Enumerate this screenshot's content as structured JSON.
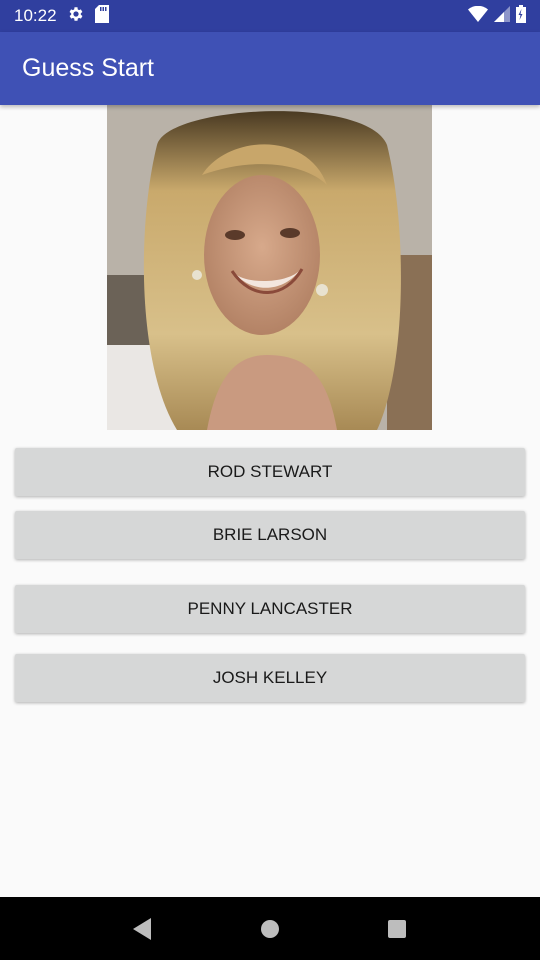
{
  "status_bar": {
    "time": "10:22",
    "icons_left": [
      "gear-icon",
      "sd-card-icon"
    ],
    "icons_right": [
      "wifi-icon",
      "signal-icon",
      "battery-icon"
    ]
  },
  "app_bar": {
    "title": "Guess Start",
    "color": "#3f51b5"
  },
  "photo": {
    "description_icon": "celebrity-photo"
  },
  "answers": [
    {
      "label": "ROD STEWART"
    },
    {
      "label": "BRIE LARSON"
    },
    {
      "label": "PENNY LANCASTER"
    },
    {
      "label": "JOSH KELLEY"
    }
  ],
  "nav_bar": {
    "buttons": [
      "back-icon",
      "home-icon",
      "recents-icon"
    ]
  }
}
